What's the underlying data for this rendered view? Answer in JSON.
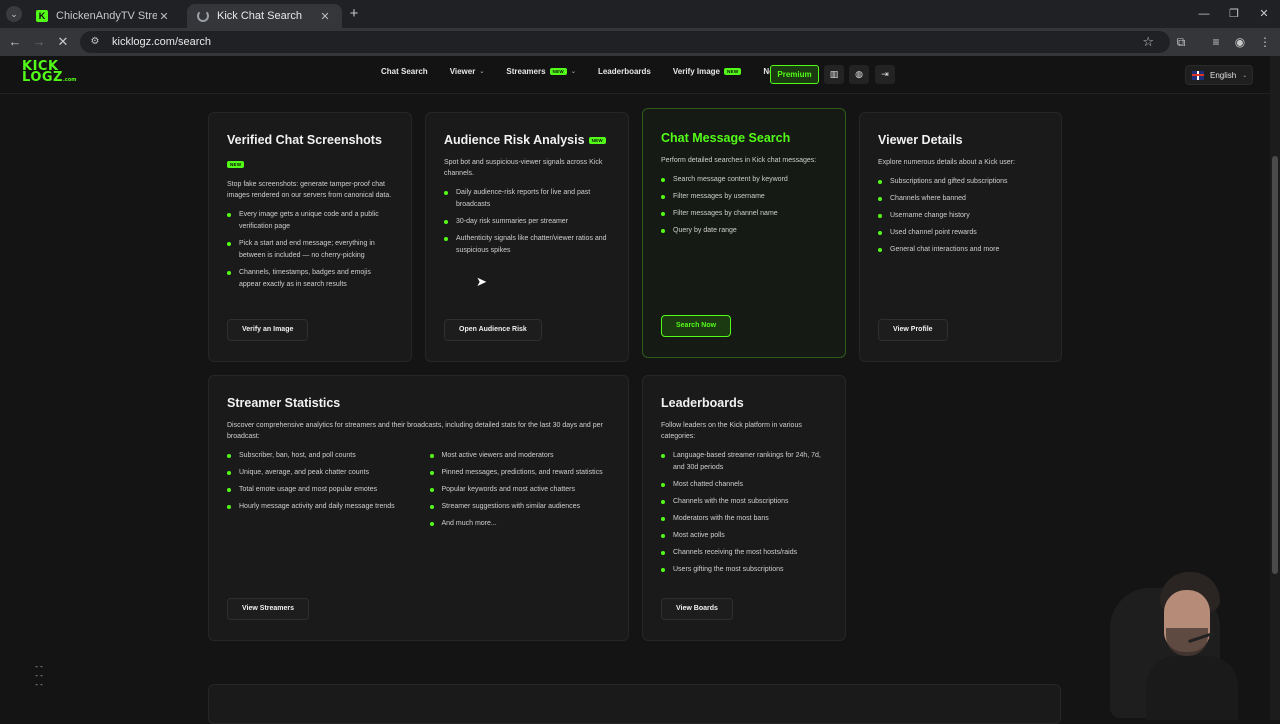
{
  "browser": {
    "tabs": [
      {
        "title": "ChickenAndyTV Stream - Watch",
        "favicon": "kick-icon"
      },
      {
        "title": "Kick Chat Search",
        "favicon": "loading-spinner-icon"
      }
    ],
    "url": "kicklogz.com/search"
  },
  "site": {
    "logo_line1": "KICK",
    "logo_line2": "LOGZ",
    "logo_suffix": ".com",
    "nav": [
      {
        "label": "Chat Search"
      },
      {
        "label": "Viewer"
      },
      {
        "label": "Streamers",
        "badge": "NEW"
      },
      {
        "label": "Leaderboards"
      },
      {
        "label": "Verify Image",
        "badge": "NEW"
      },
      {
        "label": "News"
      }
    ],
    "premium_label": "Premium",
    "language": "English",
    "accent_color": "#53fc18"
  },
  "cards": {
    "verified": {
      "title": "Verified Chat Screenshots",
      "badge": "NEW",
      "desc": "Stop fake screenshots: generate tamper-proof chat images rendered on our servers from canonical data.",
      "items": [
        "Every image gets a unique code and a public verification page",
        "Pick a start and end message; everything in between is included — no cherry-picking",
        "Channels, timestamps, badges and emojis appear exactly as in search results"
      ],
      "button": "Verify an Image"
    },
    "audience": {
      "title": "Audience Risk Analysis",
      "badge": "NEW",
      "desc": "Spot bot and suspicious-viewer signals across Kick channels.",
      "items": [
        "Daily audience-risk reports for live and past broadcasts",
        "30-day risk summaries per streamer",
        "Authenticity signals like chatter/viewer ratios and suspicious spikes"
      ],
      "button": "Open Audience Risk"
    },
    "chat_search": {
      "title": "Chat Message Search",
      "desc": "Perform detailed searches in Kick chat messages:",
      "items": [
        "Search message content by keyword",
        "Filter messages by username",
        "Filter messages by channel name",
        "Query by date range"
      ],
      "button": "Search Now"
    },
    "viewer": {
      "title": "Viewer Details",
      "desc": "Explore numerous details about a Kick user:",
      "items": [
        "Subscriptions and gifted subscriptions",
        "Channels where banned",
        "Username change history",
        "Used channel point rewards",
        "General chat interactions and more"
      ],
      "button": "View Profile"
    },
    "streamer": {
      "title": "Streamer Statistics",
      "desc": "Discover comprehensive analytics for streamers and their broadcasts, including detailed stats for the last 30 days and per broadcast:",
      "items_left": [
        "Subscriber, ban, host, and poll counts",
        "Unique, average, and peak chatter counts",
        "Total emote usage and most popular emotes",
        "Hourly message activity and daily message trends"
      ],
      "items_right": [
        "Most active viewers and moderators",
        "Pinned messages, predictions, and reward statistics",
        "Popular keywords and most active chatters",
        "Streamer suggestions with similar audiences",
        "And much more..."
      ],
      "button": "View Streamers"
    },
    "leaderboards": {
      "title": "Leaderboards",
      "desc": "Follow leaders on the Kick platform in various categories:",
      "items": [
        "Language-based streamer rankings for 24h, 7d, and 30d periods",
        "Most chatted channels",
        "Channels with the most subscriptions",
        "Moderators with the most bans",
        "Most active polls",
        "Channels receiving the most hosts/raids",
        "Users gifting the most subscriptions"
      ],
      "button": "View Boards"
    }
  }
}
